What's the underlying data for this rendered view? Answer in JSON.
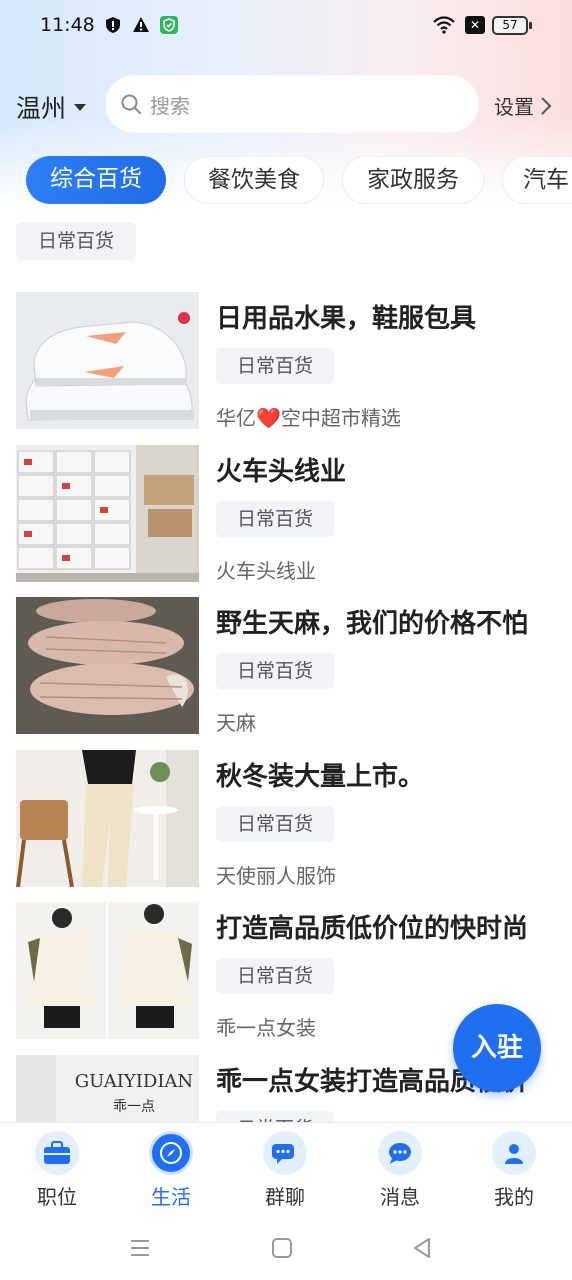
{
  "status_bar": {
    "time": "11:48",
    "battery": "57",
    "icons": [
      "shield-icon",
      "alert-icon",
      "app-shield-icon",
      "wifi-icon",
      "close-box-icon",
      "battery-icon"
    ]
  },
  "header": {
    "city": "温州",
    "search_placeholder": "搜索",
    "settings_label": "设置"
  },
  "category_tabs": [
    {
      "label": "综合百货",
      "active": true
    },
    {
      "label": "餐饮美食",
      "active": false
    },
    {
      "label": "家政服务",
      "active": false
    },
    {
      "label": "汽车",
      "active": false
    }
  ],
  "sub_filter": "日常百货",
  "listings": [
    {
      "title": "日用品水果，鞋服包具",
      "tag": "日常百货",
      "shop": "华亿❤️空中超市精选",
      "image": "sneakers"
    },
    {
      "title": "火车头线业",
      "tag": "日常百货",
      "shop": "火车头线业",
      "image": "warehouse-boxes"
    },
    {
      "title": "野生天麻，我们的价格不怕",
      "tag": "日常百货",
      "shop": "天麻",
      "image": "tianma-roots"
    },
    {
      "title": "秋冬装大量上市。",
      "tag": "日常百货",
      "shop": "天使丽人服饰",
      "image": "fashion-pants"
    },
    {
      "title": "打造高品质低价位的快时尚",
      "tag": "日常百货",
      "shop": "乖一点女装",
      "image": "fashion-jacket"
    },
    {
      "title": "乖一点女装打造高品质低价",
      "tag": "日常百货",
      "shop": "",
      "image": "brand-sign",
      "sign_text_en": "GUAIYIDIAN",
      "sign_text_cn": "乖一点"
    }
  ],
  "fab_label": "入驻",
  "bottom_nav": [
    {
      "label": "职位",
      "icon": "briefcase-icon",
      "active": false
    },
    {
      "label": "生活",
      "icon": "compass-icon",
      "active": true
    },
    {
      "label": "群聊",
      "icon": "group-chat-icon",
      "active": false
    },
    {
      "label": "消息",
      "icon": "message-icon",
      "active": false
    },
    {
      "label": "我的",
      "icon": "user-icon",
      "active": false
    }
  ],
  "colors": {
    "accent": "#1f6ff0",
    "tag_bg": "#f2f3f7"
  }
}
